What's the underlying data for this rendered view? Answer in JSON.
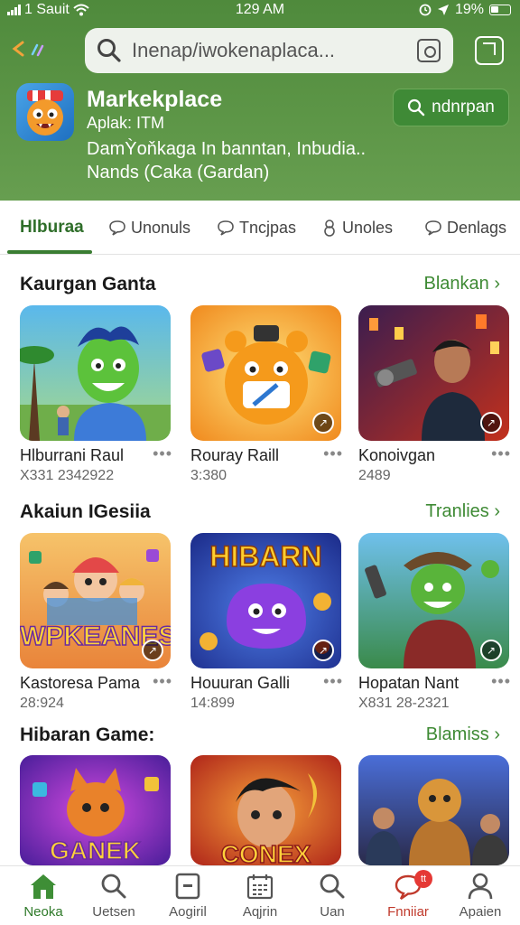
{
  "status_bar": {
    "carrier": "1 Sauit",
    "time": "129 AM",
    "battery": "19%"
  },
  "search": {
    "placeholder": "Inenap/iwokenaplaca..."
  },
  "app": {
    "title": "Markekplace",
    "subtitle": "Aplak: ITM",
    "description_line1": "DamỲoňkaga In banntan, Inbudia..",
    "description_line2": "Nands (Caka (Gardan)",
    "button_label": "ndnrpan"
  },
  "tabs": [
    {
      "label": "Hlburaa",
      "icon": "none"
    },
    {
      "label": "Unonuls",
      "icon": "chat-bubble-icon"
    },
    {
      "label": "Tncjpas",
      "icon": "chat-bubble-icon"
    },
    {
      "label": "Unoles",
      "icon": "person-outline-icon"
    },
    {
      "label": "Denlags",
      "icon": "chat-bubble-icon"
    }
  ],
  "sections": [
    {
      "title": "Kaurgan Ganta",
      "link": "Blankan",
      "cards": [
        {
          "name": "Hlburrani Raul",
          "meta": "X331 2342922"
        },
        {
          "name": "Rouray Raill",
          "meta": "3:380"
        },
        {
          "name": "Konoivgan",
          "meta": "2489"
        }
      ]
    },
    {
      "title": "Akaiun IGesiia",
      "link": "Tranlies",
      "cards": [
        {
          "name": "Kastoresa Pama",
          "meta": "28:924"
        },
        {
          "name": "Houuran Galli",
          "meta": "14:899"
        },
        {
          "name": "Hopatan Nant",
          "meta": "X831 28-2321"
        }
      ]
    },
    {
      "title": "Hibaran Game:",
      "link": "Blamiss",
      "cards": [
        {
          "name": "",
          "meta": ""
        },
        {
          "name": "",
          "meta": ""
        },
        {
          "name": "",
          "meta": ""
        }
      ]
    }
  ],
  "thumb_text": {
    "wpkeanes": "WPKEANES",
    "hibarn": "HIBARN",
    "ganek": "GANEK",
    "conex": "CONEX"
  },
  "bottom_nav": [
    {
      "label": "Neoka",
      "icon": "home-icon"
    },
    {
      "label": "Uetsen",
      "icon": "search-icon"
    },
    {
      "label": "Aogiril",
      "icon": "tablet-icon"
    },
    {
      "label": "Aqjrin",
      "icon": "calendar-icon"
    },
    {
      "label": "Uan",
      "icon": "search-icon"
    },
    {
      "label": "Fnniiar",
      "icon": "chat-bubble-icon",
      "badge": "tt"
    },
    {
      "label": "Apaien",
      "icon": "person-icon"
    }
  ],
  "colors": {
    "header_green": "#5d9647",
    "accent_green": "#3a7d32",
    "link_green": "#3e8a34",
    "alert_red": "#e53935"
  }
}
